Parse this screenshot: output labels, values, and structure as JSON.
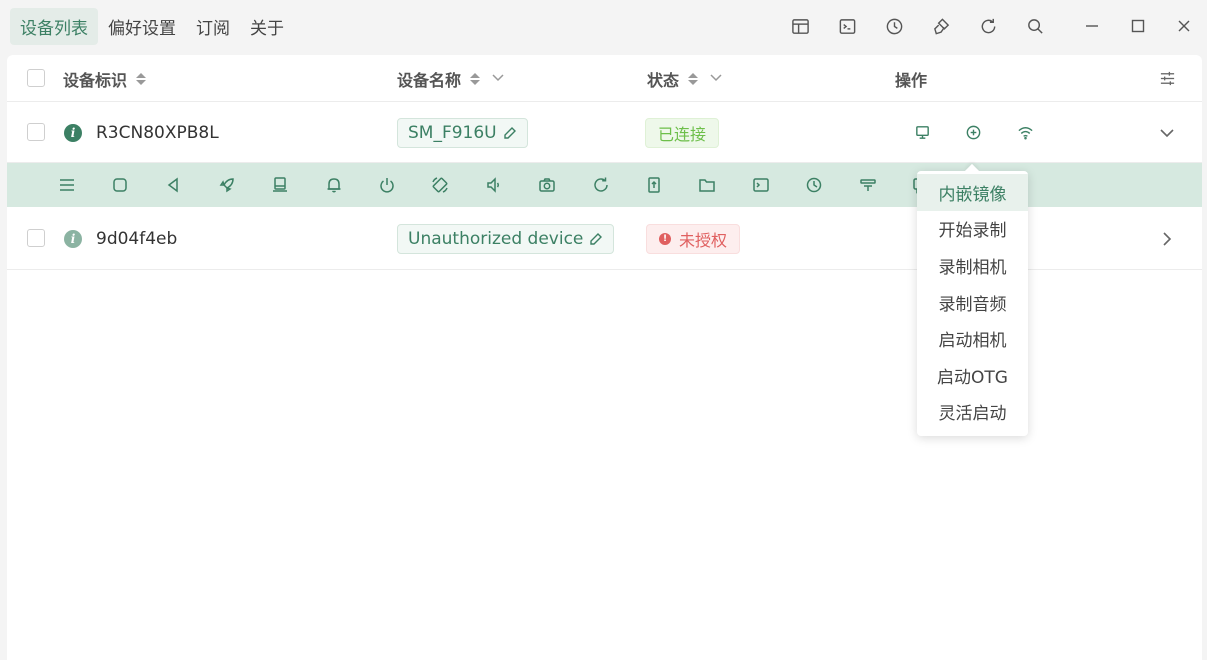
{
  "nav": {
    "items": [
      {
        "label": "设备列表",
        "active": true
      },
      {
        "label": "偏好设置",
        "active": false
      },
      {
        "label": "订阅",
        "active": false
      },
      {
        "label": "关于",
        "active": false
      }
    ]
  },
  "toolbar": {
    "icons": [
      "layout-icon",
      "terminal-icon",
      "history-icon",
      "clean-icon",
      "refresh-icon",
      "search-icon"
    ]
  },
  "window_controls": [
    "minimize-icon",
    "maximize-icon",
    "close-icon"
  ],
  "table": {
    "columns": {
      "serial": "设备标识",
      "name": "设备名称",
      "status": "状态",
      "actions": "操作"
    },
    "rows": [
      {
        "serial": "R3CN80XPB8L",
        "name": "SM_F916U",
        "status": "已连接",
        "status_type": "connected",
        "expanded": true
      },
      {
        "serial": "9d04f4eb",
        "name": "Unauthorized device",
        "status": "未授权",
        "status_type": "unauthorized",
        "expanded": false
      }
    ]
  },
  "actionbar": {
    "icons": [
      "menu-icon",
      "home-icon",
      "back-icon",
      "rocket-icon",
      "device-icon",
      "bell-icon",
      "power-icon",
      "rotate-icon",
      "volume-icon",
      "camera-icon",
      "reboot-icon",
      "upload-icon",
      "folder-icon",
      "shell-icon",
      "clock-icon",
      "filter-icon",
      "message-icon"
    ]
  },
  "dropdown": {
    "items": [
      "内嵌镜像",
      "开始录制",
      "录制相机",
      "录制音频",
      "启动相机",
      "启动OTG",
      "灵活启动"
    ]
  },
  "colors": {
    "accent": "#3c8064",
    "connected": "#6dbf4a",
    "unauthorized": "#e06060",
    "actionbar_bg": "#d6e9e0"
  }
}
